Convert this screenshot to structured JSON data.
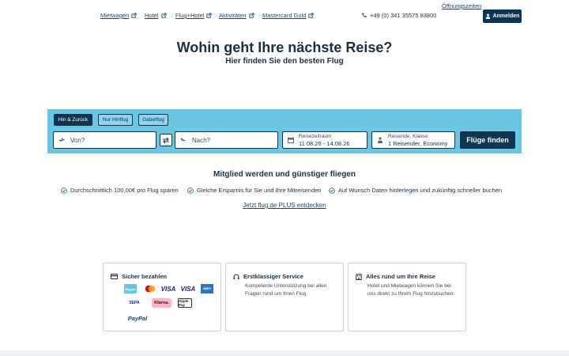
{
  "nav": {
    "links": [
      "Mietwagen",
      "Hotel",
      "Flug+Hotel",
      "Aktivitäten",
      "Mastercard Gold"
    ],
    "phone": "+49 (0) 341 35575 83800",
    "hours": "Öffnungszeiten",
    "login": "Anmelden"
  },
  "hero": {
    "title": "Wohin geht Ihre nächste Reise?",
    "subtitle": "Hier finden Sie den besten Flug"
  },
  "search": {
    "trip_types": [
      "Hin & Zurück",
      "Nur Hinflug",
      "Gabelflug"
    ],
    "active_trip": "Hin & Zurück",
    "from_placeholder": "Von?",
    "to_placeholder": "Nach?",
    "dates_label": "Reisezeitraum",
    "dates_value": "11.08.26 - 14.08.26",
    "travelers_label": "Reisende, Klasse",
    "travelers_value": "1 Reisender, Economy",
    "submit": "Flüge finden"
  },
  "member": {
    "title": "Mitglied werden und günstiger fliegen",
    "benefits": [
      "Durchschnittlich 100,00€ pro Flug sparen",
      "Gleiche Ersparnis für Sie und Ihre Mitreisenden",
      "Auf Wunsch Daten hinterlegen und zukünftig schneller buchen"
    ],
    "link": "Jetzt flug.de PLUS entdecken"
  },
  "cards": {
    "payment": {
      "title": "Sicher bezahlen",
      "methods": [
        "flug.de",
        "Mastercard",
        "VISA",
        "VISA",
        "AMEX",
        "SEPA",
        "Klarna.",
        "Apple Pay",
        "PayPal"
      ]
    },
    "service": {
      "title": "Erstklassiger Service",
      "text": "Kompetente Unterstützung bei allen Fragen rund um Ihren Flug."
    },
    "travel": {
      "title": "Alles rund um Ihre Reise",
      "text": "Hotel und Mietwagen können Sie bei uns direkt zu Ihrem Flug hinzubuchen."
    }
  },
  "colors": {
    "primary": "#0e3552",
    "search_bg": "#6bc6e4",
    "link": "#17486b"
  }
}
